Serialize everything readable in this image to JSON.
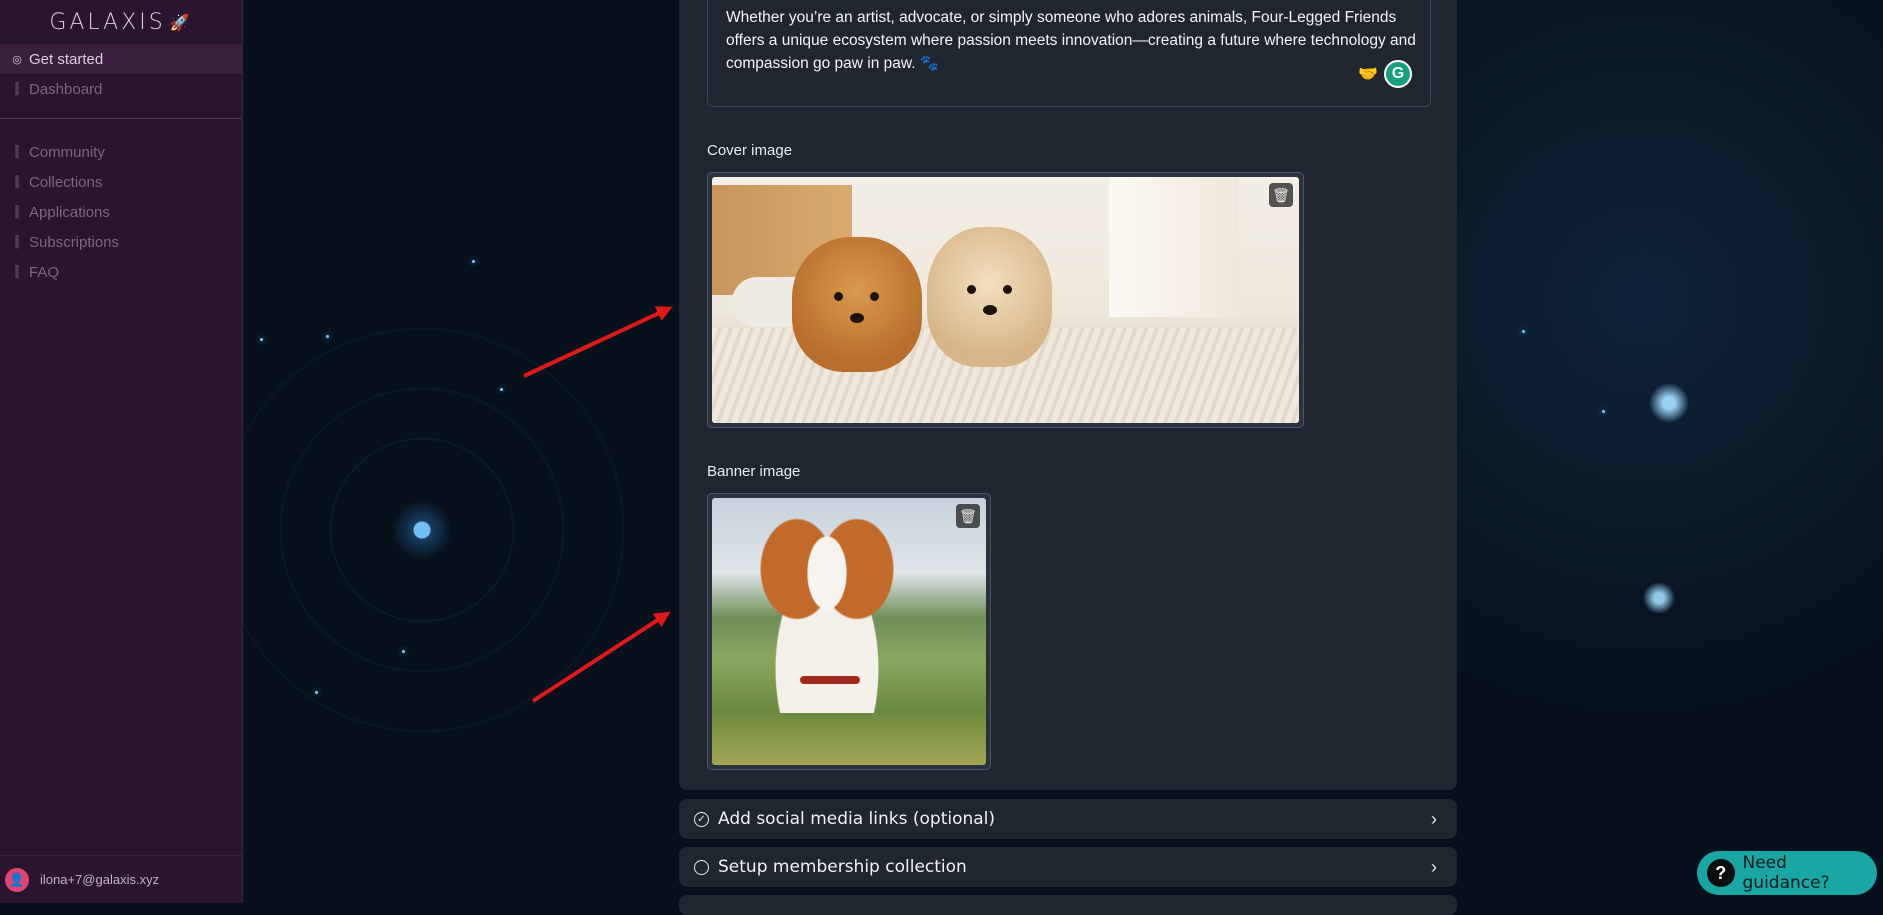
{
  "sidebar": {
    "logo": "GALAXIS",
    "items_top": [
      {
        "label": "Get started",
        "icon": "check-circle-icon",
        "active": true
      },
      {
        "label": "Dashboard",
        "icon": "waveform-icon",
        "active": false
      }
    ],
    "items_bottom": [
      {
        "label": "Community",
        "icon": "waveform-icon"
      },
      {
        "label": "Collections",
        "icon": "waveform-icon"
      },
      {
        "label": "Applications",
        "icon": "waveform-icon"
      },
      {
        "label": "Subscriptions",
        "icon": "waveform-icon"
      },
      {
        "label": "FAQ",
        "icon": "waveform-icon"
      }
    ],
    "user_email": "ilona+7@galaxis.xyz"
  },
  "main": {
    "description": "Whether you’re an artist, advocate, or simply someone who adores animals, Four-Legged Friends offers a unique ecosystem where passion meets innovation—creating a future where technology and compassion go paw in paw. 🐾",
    "cover_label": "Cover image",
    "banner_label": "Banner image"
  },
  "accordion": [
    {
      "label": "Add social media links (optional)",
      "checked": true
    },
    {
      "label": "Setup membership collection",
      "checked": false
    }
  ],
  "help": {
    "label": "Need guidance?"
  },
  "colors": {
    "sidebar_bg": "#2a1530",
    "panel_bg": "#1f2630",
    "accent_help": "#1aa6a3",
    "arrow": "#e01818",
    "avatar": "#e5426d"
  }
}
